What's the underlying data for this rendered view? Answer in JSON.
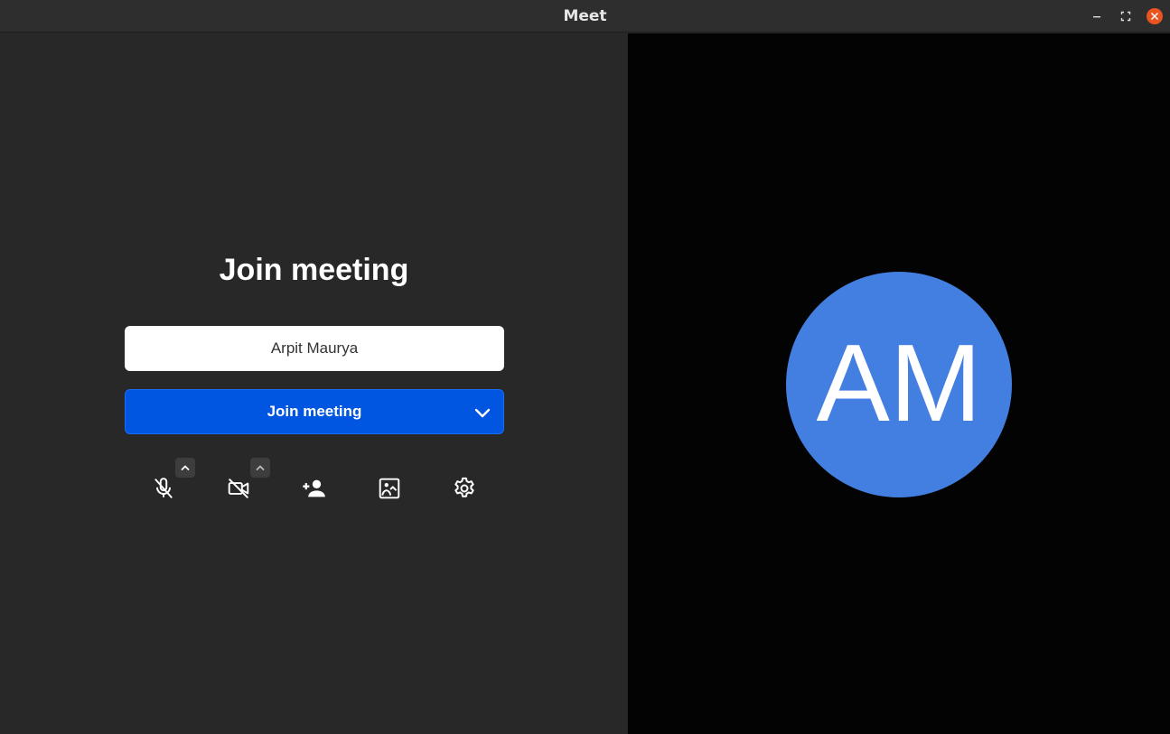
{
  "window": {
    "title": "Meet",
    "controls": {
      "minimize": "minimize-icon",
      "maximize": "maximize-icon",
      "close": "close-icon"
    },
    "close_color": "#e95420"
  },
  "prejoin": {
    "heading": "Join meeting",
    "name_input": {
      "value": "Arpit Maurya",
      "placeholder": ""
    },
    "join_button": {
      "label": "Join meeting",
      "dropdown_icon": "chevron-down-icon",
      "color": "#0056e0"
    },
    "toolbar": [
      {
        "icon": "mic-off-icon",
        "has_options": true
      },
      {
        "icon": "camera-off-icon",
        "has_options": true
      },
      {
        "icon": "invite-person-icon",
        "has_options": false
      },
      {
        "icon": "background-image-icon",
        "has_options": false
      },
      {
        "icon": "settings-icon",
        "has_options": false
      }
    ]
  },
  "preview": {
    "avatar_initials": "AM",
    "avatar_color": "#437fe0"
  }
}
